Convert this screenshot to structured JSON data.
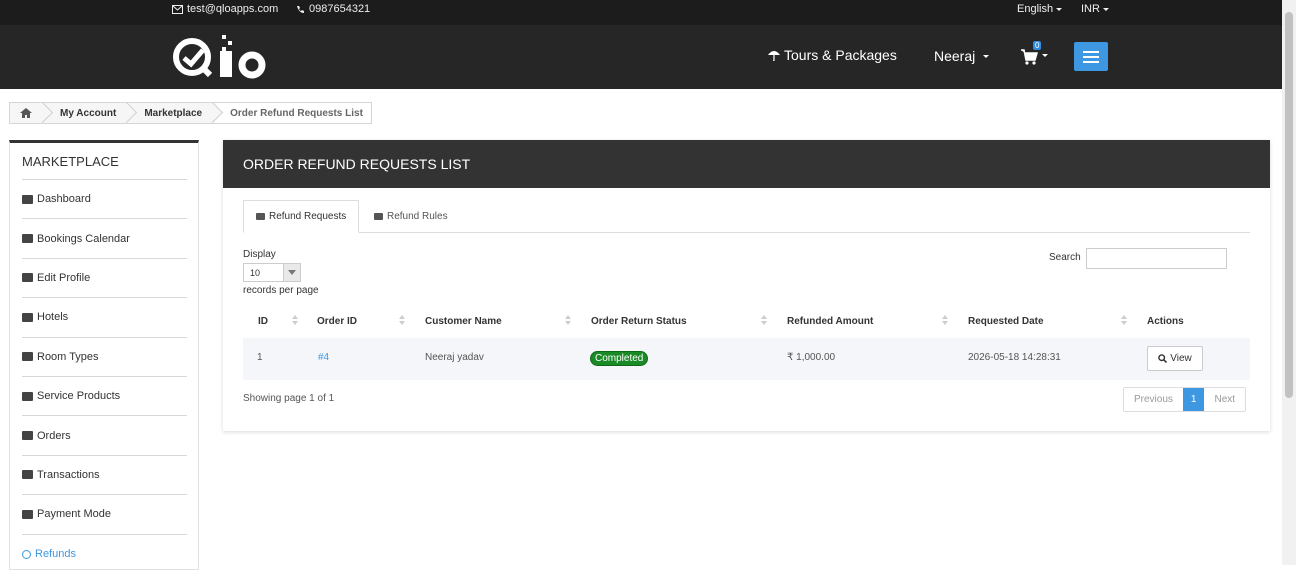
{
  "topbar": {
    "email": "test@qloapps.com",
    "phone": "0987654321",
    "language": "English",
    "currency": "INR"
  },
  "header": {
    "logo_text": "Qlo",
    "tours_label": "Tours & Packages",
    "user_name": "Neeraj",
    "cart_count": "0"
  },
  "breadcrumb": {
    "items": [
      "My Account",
      "Marketplace",
      "Order Refund Requests List"
    ]
  },
  "sidebar": {
    "title": "MARKETPLACE",
    "items": [
      {
        "label": "Dashboard",
        "icon": "dashboard-icon"
      },
      {
        "label": "Bookings Calendar",
        "icon": "bar-chart-icon"
      },
      {
        "label": "Edit Profile",
        "icon": "user-icon"
      },
      {
        "label": "Hotels",
        "icon": "building-icon"
      },
      {
        "label": "Room Types",
        "icon": "bed-icon"
      },
      {
        "label": "Service Products",
        "icon": "user-plus-icon"
      },
      {
        "label": "Orders",
        "icon": "credit-card-icon"
      },
      {
        "label": "Transactions",
        "icon": "money-icon"
      },
      {
        "label": "Payment Mode",
        "icon": "money-icon"
      },
      {
        "label": "Refunds",
        "icon": "undo-icon",
        "active": true
      }
    ]
  },
  "panel": {
    "title": "ORDER REFUND REQUESTS LIST",
    "tabs": [
      {
        "label": "Refund Requests",
        "icon": "gift-icon",
        "active": true
      },
      {
        "label": "Refund Rules",
        "icon": "money-icon"
      }
    ],
    "display_label": "Display",
    "display_value": "10",
    "records_label": "records per page",
    "search_label": "Search",
    "columns": [
      "ID",
      "Order ID",
      "Customer Name",
      "Order Return Status",
      "Refunded Amount",
      "Requested Date",
      "Actions"
    ],
    "rows": [
      {
        "id": "1",
        "order_id": "#4",
        "customer": "Neeraj yadav",
        "status": "Completed",
        "amount": "₹ 1,000.00",
        "date": "2026-05-18 14:28:31",
        "action": "View"
      }
    ],
    "showing": "Showing page 1 of 1",
    "pager": {
      "prev": "Previous",
      "current": "1",
      "next": "Next"
    }
  },
  "colors": {
    "accent": "#3d97e1",
    "header_bg": "#262626",
    "status_completed": "#1a8a26"
  }
}
